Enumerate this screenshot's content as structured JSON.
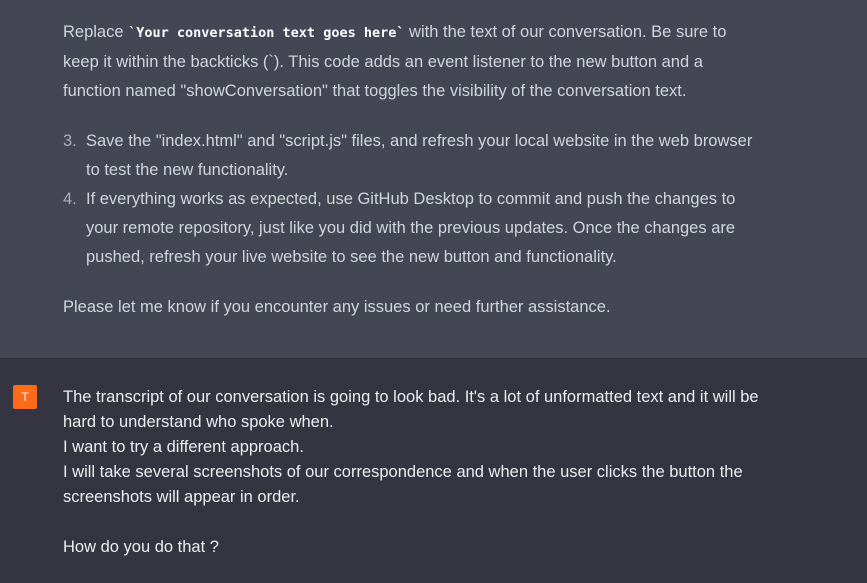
{
  "assistant": {
    "para1_prefix": "Replace ",
    "para1_code": "`Your conversation text goes here`",
    "para1_suffix": " with the text of our conversation. Be sure to keep it within the backticks (`). This code adds an event listener to the new button and a function named \"showConversation\" that toggles the visibility of the conversation text.",
    "steps": [
      {
        "num": "3.",
        "text": "Save the \"index.html\" and \"script.js\" files, and refresh your local website in the web browser to test the new functionality."
      },
      {
        "num": "4.",
        "text": "If everything works as expected, use GitHub Desktop to commit and push the changes to your remote repository, just like you did with the previous updates. Once the changes are pushed, refresh your live website to see the new button and functionality."
      }
    ],
    "closing": "Please let me know if you encounter any issues or need further assistance."
  },
  "user": {
    "avatar_letter": "T",
    "avatar_color": "#ff6b1a",
    "lines": [
      "The transcript of our conversation is going to look bad. It's a lot of unformatted text and it will be hard to understand who spoke when.",
      "I want to try a different approach.",
      "I will take several screenshots of our correspondence and when the user clicks the button the screenshots will appear in order.",
      "How do you do that ?"
    ]
  },
  "colors": {
    "assistant_bg": "#444654",
    "user_bg": "#343541"
  }
}
